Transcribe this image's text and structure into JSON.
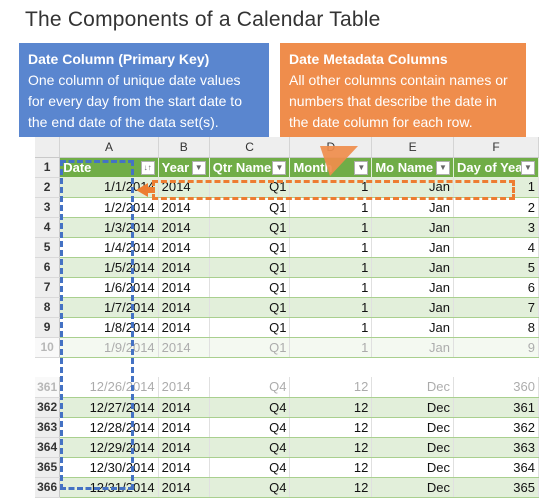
{
  "title": "The Components of a Calendar Table",
  "callouts": {
    "date_column": {
      "heading": "Date Column (Primary Key)",
      "text": "One column of unique date values for every day from the start date to the end date of the data set(s).",
      "color": "#5a86cf"
    },
    "metadata_columns": {
      "heading": "Date Metadata Columns",
      "text": "All other columns contain names or numbers that describe the date in the date column for each row.",
      "color": "#ef8d4c"
    }
  },
  "sheet": {
    "column_letters": [
      "A",
      "B",
      "C",
      "D",
      "E",
      "F"
    ],
    "header_row_number": "1",
    "headers": [
      "Date",
      "Year",
      "Qtr Name",
      "Month",
      "Mo Name",
      "Day of Year"
    ],
    "header_color": "#70ad47",
    "band_color": "#e2efda",
    "top_rows": [
      {
        "rn": "2",
        "date": "1/1/2014",
        "year": "2014",
        "qtr": "Q1",
        "month": "1",
        "mo": "Jan",
        "doy": "1"
      },
      {
        "rn": "3",
        "date": "1/2/2014",
        "year": "2014",
        "qtr": "Q1",
        "month": "1",
        "mo": "Jan",
        "doy": "2"
      },
      {
        "rn": "4",
        "date": "1/3/2014",
        "year": "2014",
        "qtr": "Q1",
        "month": "1",
        "mo": "Jan",
        "doy": "3"
      },
      {
        "rn": "5",
        "date": "1/4/2014",
        "year": "2014",
        "qtr": "Q1",
        "month": "1",
        "mo": "Jan",
        "doy": "4"
      },
      {
        "rn": "6",
        "date": "1/5/2014",
        "year": "2014",
        "qtr": "Q1",
        "month": "1",
        "mo": "Jan",
        "doy": "5"
      },
      {
        "rn": "7",
        "date": "1/6/2014",
        "year": "2014",
        "qtr": "Q1",
        "month": "1",
        "mo": "Jan",
        "doy": "6"
      },
      {
        "rn": "8",
        "date": "1/7/2014",
        "year": "2014",
        "qtr": "Q1",
        "month": "1",
        "mo": "Jan",
        "doy": "7"
      },
      {
        "rn": "9",
        "date": "1/8/2014",
        "year": "2014",
        "qtr": "Q1",
        "month": "1",
        "mo": "Jan",
        "doy": "8"
      },
      {
        "rn": "10",
        "date": "1/9/2014",
        "year": "2014",
        "qtr": "Q1",
        "month": "1",
        "mo": "Jan",
        "doy": "9"
      }
    ],
    "bottom_rows": [
      {
        "rn": "361",
        "date": "12/26/2014",
        "year": "2014",
        "qtr": "Q4",
        "month": "12",
        "mo": "Dec",
        "doy": "360"
      },
      {
        "rn": "362",
        "date": "12/27/2014",
        "year": "2014",
        "qtr": "Q4",
        "month": "12",
        "mo": "Dec",
        "doy": "361"
      },
      {
        "rn": "363",
        "date": "12/28/2014",
        "year": "2014",
        "qtr": "Q4",
        "month": "12",
        "mo": "Dec",
        "doy": "362"
      },
      {
        "rn": "364",
        "date": "12/29/2014",
        "year": "2014",
        "qtr": "Q4",
        "month": "12",
        "mo": "Dec",
        "doy": "363"
      },
      {
        "rn": "365",
        "date": "12/30/2014",
        "year": "2014",
        "qtr": "Q4",
        "month": "12",
        "mo": "Dec",
        "doy": "364"
      },
      {
        "rn": "366",
        "date": "12/31/2014",
        "year": "2014",
        "qtr": "Q4",
        "month": "12",
        "mo": "Dec",
        "doy": "365"
      }
    ]
  }
}
